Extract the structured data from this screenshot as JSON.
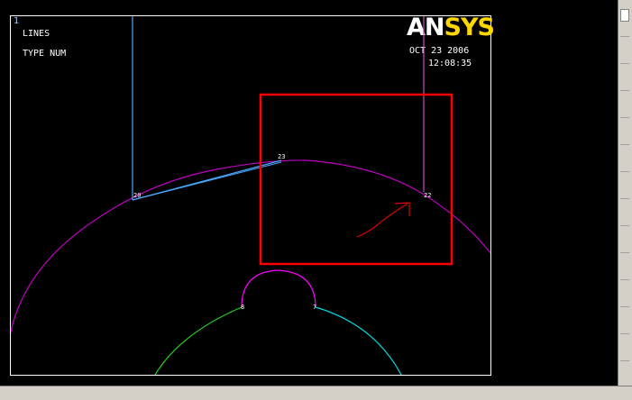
{
  "window_number": "1",
  "plot_labels": {
    "line1": "LINES",
    "line2": "TYPE NUM"
  },
  "logo": {
    "part1": "AN",
    "part2": "SYS"
  },
  "date": "OCT 23 2006",
  "time": "12:08:35",
  "keypoints": {
    "k20": "20",
    "k23": "23",
    "k22": "22",
    "k8": "8",
    "k7": "7"
  },
  "colors": {
    "background": "#000000",
    "frame": "#ffffff",
    "outer_arc": "#c000c0",
    "blue_lines": "#4aa8ff",
    "right_vertical": "#c050c0",
    "top_semicircle": "#ff00ff",
    "green_arc": "#20d020",
    "cyan_arc": "#00d8e0",
    "highlight_box": "#ff0000",
    "pointer_arrow": "#e00000",
    "logo_accent": "#ffd700"
  }
}
